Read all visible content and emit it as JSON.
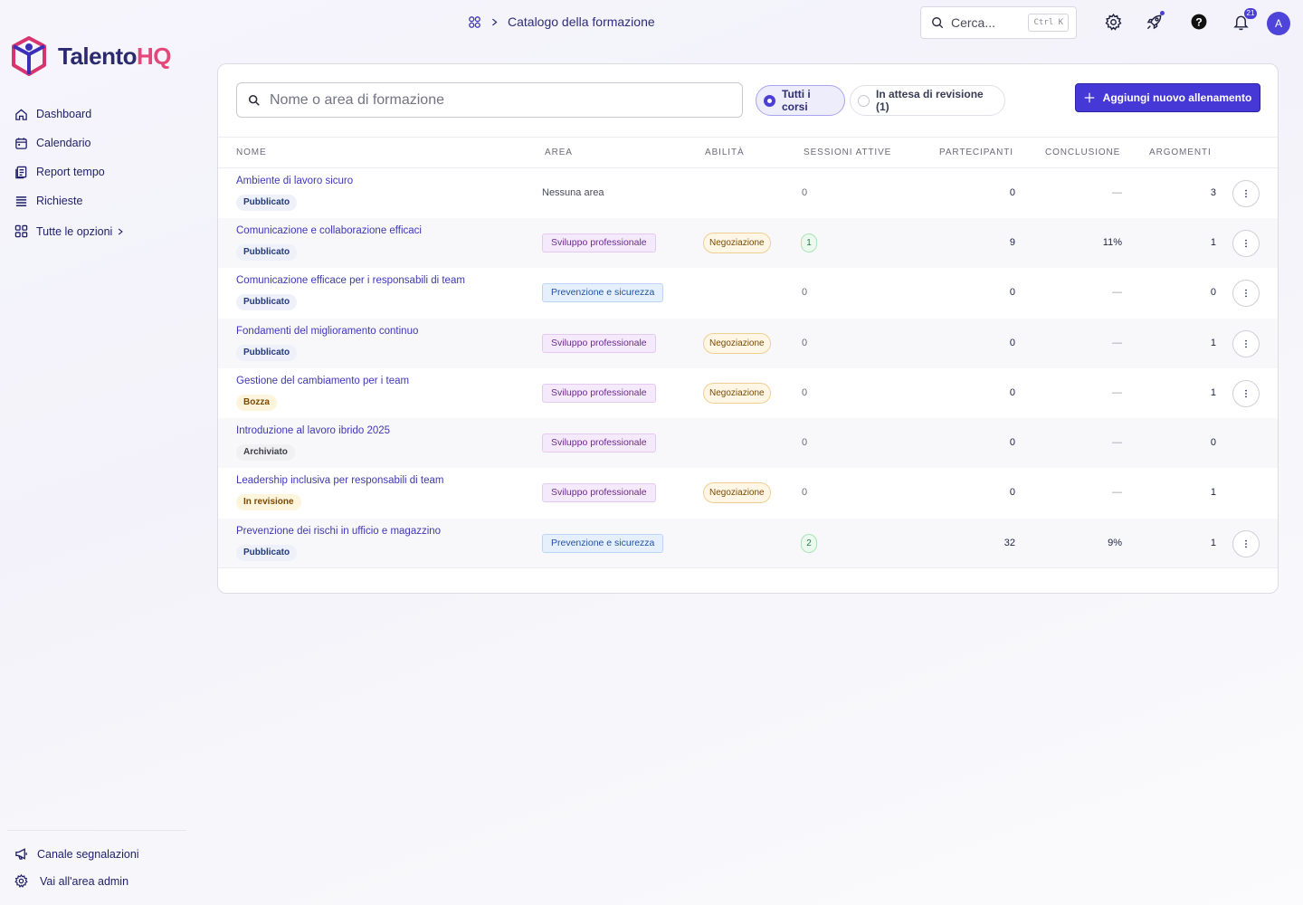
{
  "app": {
    "brand_main": "Talento",
    "brand_accent": "HQ",
    "accent_color": "#4538d6",
    "brand_pink": "#e6477a"
  },
  "sidebar": {
    "items": [
      {
        "label": "Dashboard",
        "icon": "home-icon"
      },
      {
        "label": "Calendario",
        "icon": "calendar-icon"
      },
      {
        "label": "Report tempo",
        "icon": "report-icon"
      },
      {
        "label": "Richieste",
        "icon": "list-icon"
      }
    ],
    "all_options": "Tutte le opzioni",
    "bottom": {
      "report_channel": "Canale segnalazioni",
      "admin": "Vai all'area admin"
    }
  },
  "header": {
    "breadcrumb": "Catalogo della formazione",
    "search_placeholder": "Cerca...",
    "search_shortcut": "Ctrl K",
    "notifications_count": "21",
    "avatar_initial": "A"
  },
  "toolbar": {
    "search_placeholder": "Nome o area di formazione",
    "filter_all": "Tutti i corsi",
    "filter_review": "In attesa di revisione (1)",
    "add_button": "Aggiungi nuovo allenamento"
  },
  "table": {
    "columns": {
      "name": "NOME",
      "area": "AREA",
      "skill": "ABILITÀ",
      "sessions": "SESSIONI ATTIVE",
      "participants": "PARTECIPANTI",
      "completion": "CONCLUSIONE",
      "topics": "ARGOMENTI"
    },
    "rows": [
      {
        "name": "Ambiente di lavoro sicuro",
        "status": "Pubblicato",
        "status_type": "pub",
        "area": "Nessuna area",
        "area_type": "none",
        "skill": "",
        "sessions": "0",
        "sessions_badge": false,
        "participants": "0",
        "completion": "—",
        "topics": "3",
        "menu": true
      },
      {
        "name": "Comunicazione e collaborazione efficaci",
        "status": "Pubblicato",
        "status_type": "pub",
        "area": "Sviluppo professionale",
        "area_type": "dev",
        "skill": "Negoziazione",
        "sessions": "1",
        "sessions_badge": true,
        "participants": "9",
        "completion": "11%",
        "topics": "1",
        "menu": true
      },
      {
        "name": "Comunicazione efficace per i responsabili di team",
        "status": "Pubblicato",
        "status_type": "pub",
        "area": "Prevenzione e sicurezza",
        "area_type": "safe",
        "skill": "",
        "sessions": "0",
        "sessions_badge": false,
        "participants": "0",
        "completion": "—",
        "topics": "0",
        "menu": true
      },
      {
        "name": "Fondamenti del miglioramento continuo",
        "status": "Pubblicato",
        "status_type": "pub",
        "area": "Sviluppo professionale",
        "area_type": "dev",
        "skill": "Negoziazione",
        "sessions": "0",
        "sessions_badge": false,
        "participants": "0",
        "completion": "—",
        "topics": "1",
        "menu": true
      },
      {
        "name": "Gestione del cambiamento per i team",
        "status": "Bozza",
        "status_type": "draft",
        "area": "Sviluppo professionale",
        "area_type": "dev",
        "skill": "Negoziazione",
        "sessions": "0",
        "sessions_badge": false,
        "participants": "0",
        "completion": "—",
        "topics": "1",
        "menu": true
      },
      {
        "name": "Introduzione al lavoro ibrido 2025",
        "status": "Archiviato",
        "status_type": "arch",
        "area": "Sviluppo professionale",
        "area_type": "dev",
        "skill": "",
        "sessions": "0",
        "sessions_badge": false,
        "participants": "0",
        "completion": "—",
        "topics": "0",
        "menu": false
      },
      {
        "name": "Leadership inclusiva per responsabili di team",
        "status": "In revisione",
        "status_type": "rev",
        "area": "Sviluppo professionale",
        "area_type": "dev",
        "skill": "Negoziazione",
        "sessions": "0",
        "sessions_badge": false,
        "participants": "0",
        "completion": "—",
        "topics": "1",
        "menu": false
      },
      {
        "name": "Prevenzione dei rischi in ufficio e magazzino",
        "status": "Pubblicato",
        "status_type": "pub",
        "area": "Prevenzione e sicurezza",
        "area_type": "safe",
        "skill": "",
        "sessions": "2",
        "sessions_badge": true,
        "participants": "32",
        "completion": "9%",
        "topics": "1",
        "menu": true
      }
    ]
  }
}
